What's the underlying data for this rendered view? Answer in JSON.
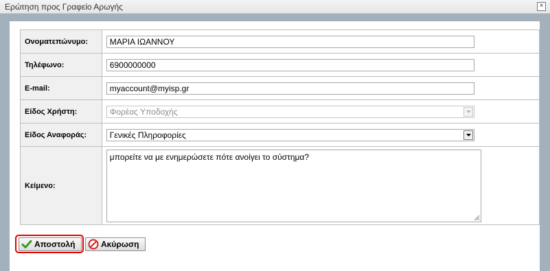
{
  "dialog": {
    "title": "Ερώτηση προς Γραφείο Αρωγής",
    "close_glyph": "×"
  },
  "form": {
    "name": {
      "label": "Ονοματεπώνυμο:",
      "value": "ΜΑΡΙΑ ΙΩΑΝΝΟΥ"
    },
    "phone": {
      "label": "Τηλέφωνο:",
      "value": "6900000000"
    },
    "email": {
      "label": "E-mail:",
      "value": "myaccount@myisp.gr"
    },
    "user_type": {
      "label": "Είδος Χρήστη:",
      "value": "Φορέας Υποδοχής",
      "disabled": true
    },
    "report_type": {
      "label": "Είδος Αναφοράς:",
      "value": "Γενικές Πληροφορίες"
    },
    "text": {
      "label": "Κείμενο:",
      "value": "μπορείτε να με ενημερώσετε πότε ανοίγει το σύστημα?"
    }
  },
  "buttons": {
    "send_label": "Αποστολή",
    "cancel_label": "Ακύρωση"
  },
  "icons": {
    "send": "checkmark-icon",
    "cancel": "cancel-icon",
    "dropdown": "chevron-down-icon"
  },
  "colors": {
    "highlight": "#e00000",
    "check": "#3a9a1e",
    "cancel": "#d42020"
  }
}
